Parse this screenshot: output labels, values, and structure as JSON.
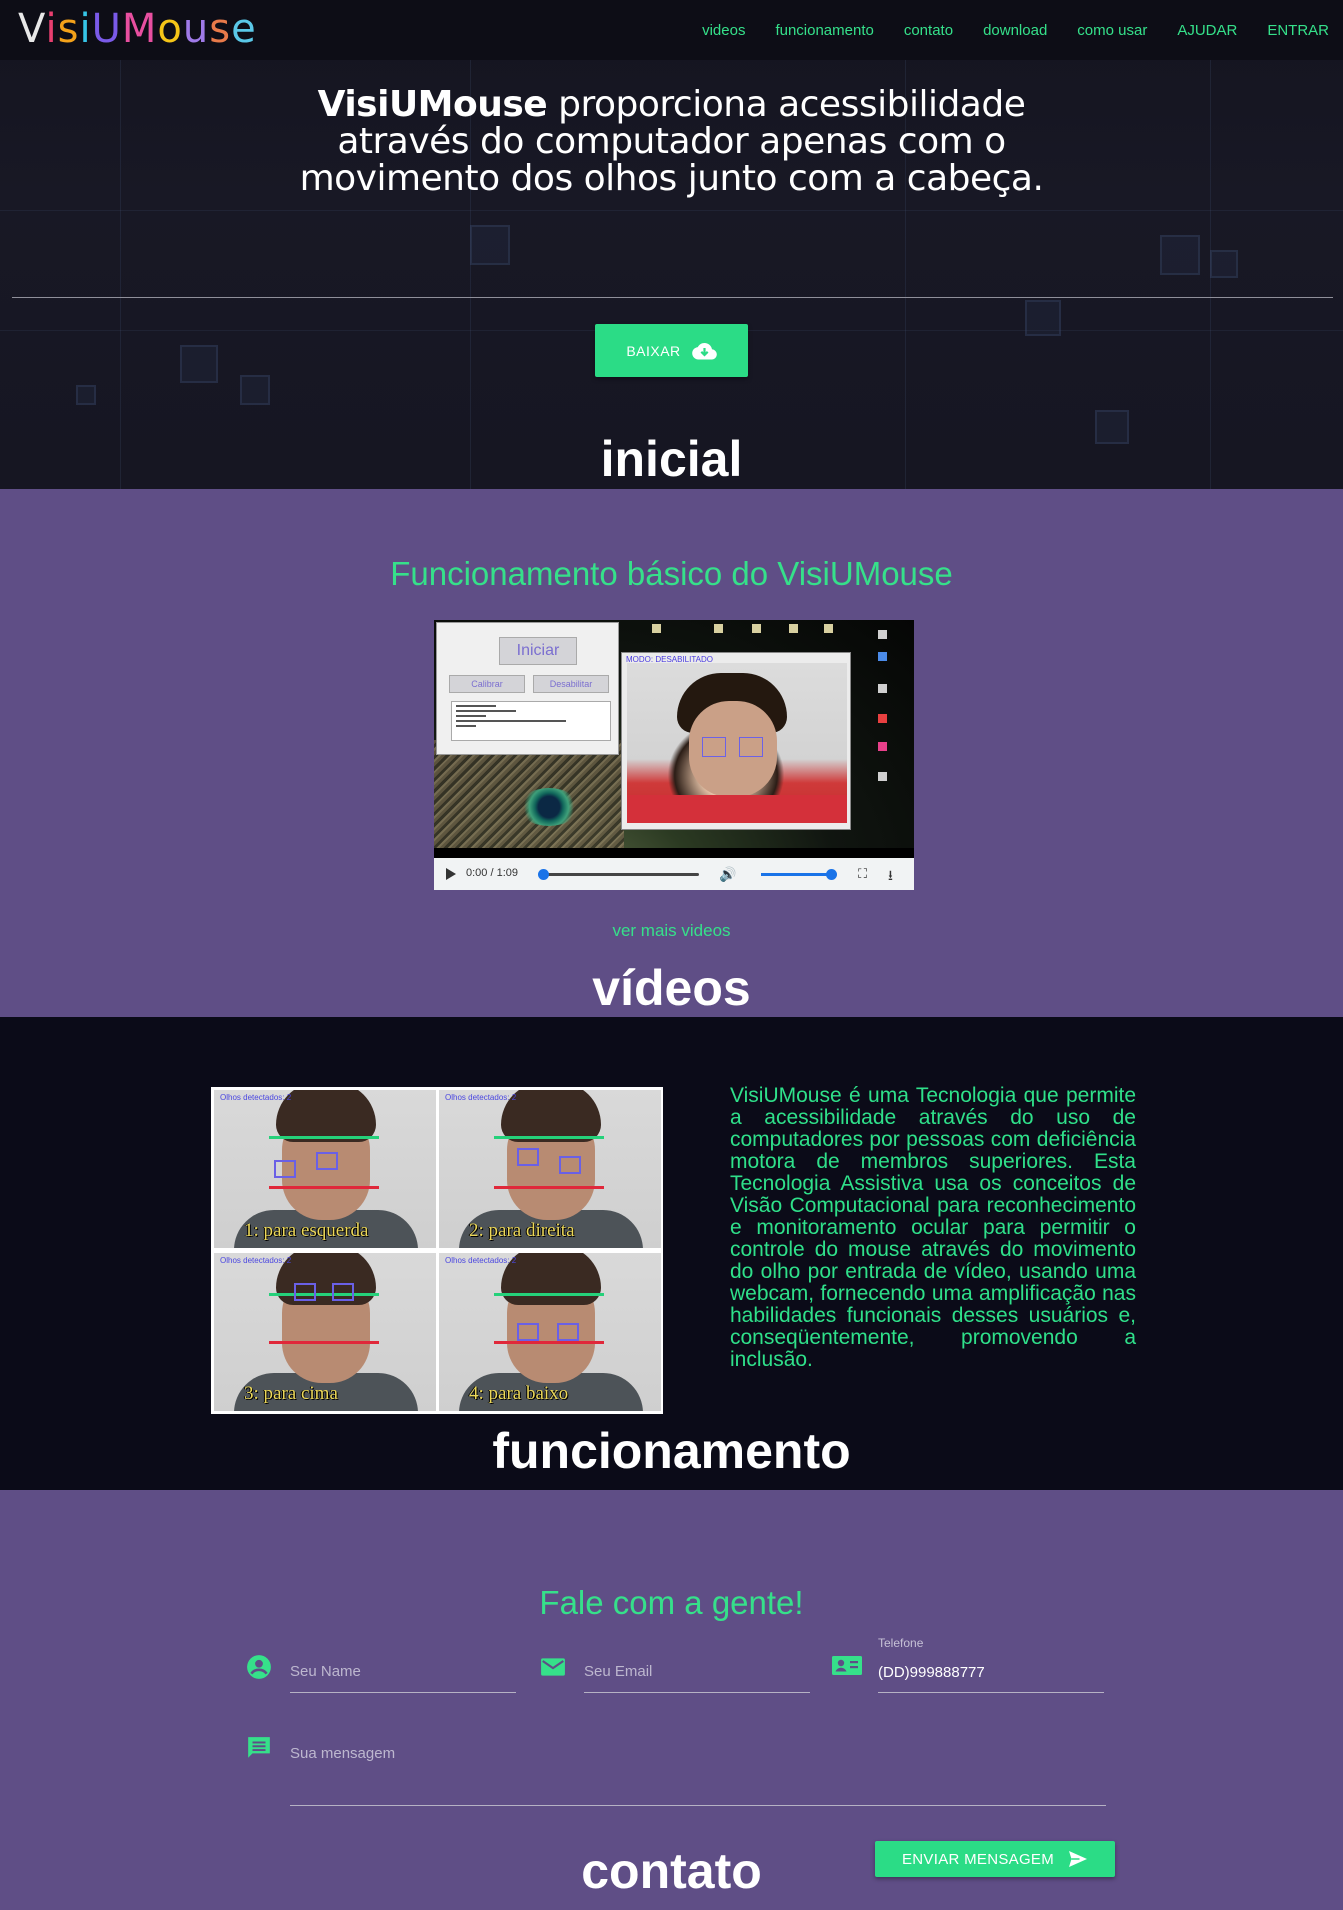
{
  "logo": {
    "letters": [
      "V",
      "i",
      "s",
      "i",
      "U",
      "M",
      "o",
      "u",
      "s",
      "e"
    ],
    "text": "VisiUMouse"
  },
  "nav": {
    "items": [
      "videos",
      "funcionamento",
      "contato",
      "download",
      "como usar",
      "AJUDAR",
      "ENTRAR"
    ]
  },
  "hero": {
    "brand": "VisiUMouse",
    "tagline": " proporciona acessibilidade através do computador apenas com o movimento dos olhos junto com a cabeça.",
    "download_label": "BAIXAR",
    "download_icon": "cloud-download-icon",
    "section_label": "inicial"
  },
  "videos": {
    "title": "Funcionamento básico do VisiUMouse",
    "player": {
      "time": "0:00 / 1:09",
      "progress": 0,
      "volume": 1.0,
      "app_buttons": {
        "start": "Iniciar",
        "calibrate": "Calibrar",
        "disable": "Desabilitar"
      },
      "cam_mode": "MODO: DESABILITADO"
    },
    "more_link": "ver mais videos",
    "section_label": "vídeos"
  },
  "funcionamento": {
    "panels": [
      {
        "detected": "Olhos detectados: 2",
        "caption": "1: para esquerda"
      },
      {
        "detected": "Olhos detectados: 2",
        "caption": "2: para direita"
      },
      {
        "detected": "Olhos detectados: 2",
        "caption": "3: para cima"
      },
      {
        "detected": "Olhos detectados: 2",
        "caption": "4: para baixo"
      }
    ],
    "description": "VisiUMouse é uma Tecnologia que permite a acessibilidade através do uso de computadores por pessoas com deficiência motora de membros superiores. Esta Tecnologia Assistiva usa os conceitos de Visão Computacional para reconhecimento e monitoramento ocular para permitir o controle do mouse através do movimento do olho por entrada de vídeo, usando uma webcam, fornecendo uma amplificação nas habilidades funcionais desses usuários e, conseqüentemente, promovendo a inclusão.",
    "section_label": "funcionamento"
  },
  "contato": {
    "title": "Fale com a gente!",
    "name_placeholder": "Seu Name",
    "email_placeholder": "Seu Email",
    "phone_label": "Telefone",
    "phone_value": "(DD)999888777",
    "message_placeholder": "Sua mensagem",
    "send_label": "ENVIAR MENSAGEM",
    "send_icon": "send-icon",
    "section_label": "contato"
  },
  "colors": {
    "accent": "#2bdc86",
    "purple": "#5f4e86",
    "dark": "#0b0b18"
  }
}
